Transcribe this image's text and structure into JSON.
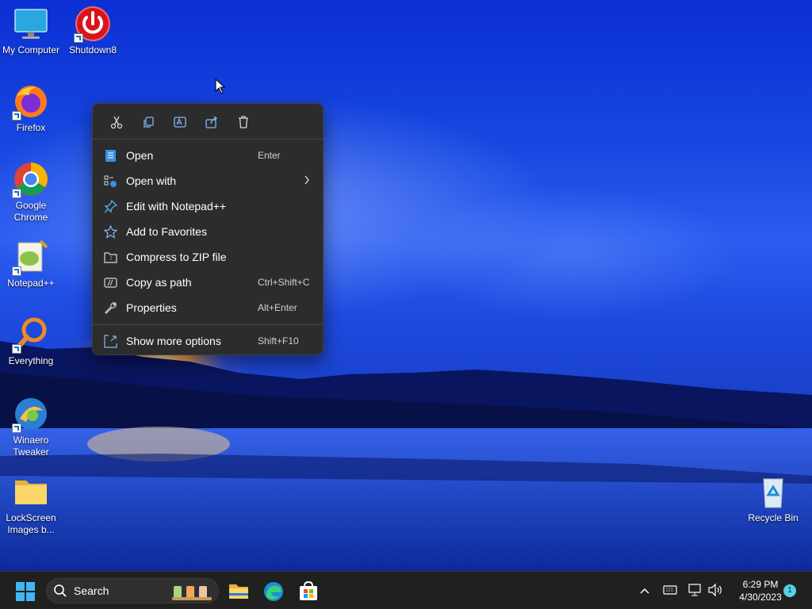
{
  "desktop_icons": [
    {
      "label": "My Computer",
      "icon": "monitor-icon"
    },
    {
      "label": "Shutdown8",
      "icon": "power-icon"
    },
    {
      "label": "Firefox",
      "icon": "firefox-icon"
    },
    {
      "label": "Google Chrome",
      "icon": "chrome-icon"
    },
    {
      "label": "Notepad++",
      "icon": "notepadpp-icon"
    },
    {
      "label": "Everything",
      "icon": "magnifier-icon"
    },
    {
      "label": "Winaero Tweaker",
      "icon": "winaero-icon"
    },
    {
      "label": "LockScreen Images b...",
      "icon": "folder-icon"
    },
    {
      "label": "Recycle Bin",
      "icon": "recycle-bin-icon"
    }
  ],
  "context_menu": {
    "toolbar": [
      "cut-icon",
      "copy-icon",
      "rename-icon",
      "share-icon",
      "delete-icon"
    ],
    "items": [
      {
        "label": "Open",
        "shortcut": "Enter",
        "icon": "notepad-icon"
      },
      {
        "label": "Open with",
        "shortcut": "",
        "icon": "open-with-icon",
        "submenu": true
      },
      {
        "label": "Edit with Notepad++",
        "shortcut": "",
        "icon": "pin-icon"
      },
      {
        "label": "Add to Favorites",
        "shortcut": "",
        "icon": "star-icon"
      },
      {
        "label": "Compress to ZIP file",
        "shortcut": "",
        "icon": "zip-icon"
      },
      {
        "label": "Copy as path",
        "shortcut": "Ctrl+Shift+C",
        "icon": "path-icon"
      },
      {
        "label": "Properties",
        "shortcut": "Alt+Enter",
        "icon": "wrench-icon"
      }
    ],
    "more": {
      "label": "Show more options",
      "shortcut": "Shift+F10",
      "icon": "more-options-icon"
    }
  },
  "taskbar": {
    "search_placeholder": "Search",
    "apps": [
      "start-icon",
      "file-explorer-icon",
      "edge-icon",
      "store-icon"
    ],
    "clock_time": "6:29 PM",
    "clock_date": "4/30/2023",
    "notification_count": "1"
  },
  "colors": {
    "menu_bg": "#2c2c2c",
    "taskbar_bg": "#202020",
    "accent": "#5ad0e6"
  }
}
